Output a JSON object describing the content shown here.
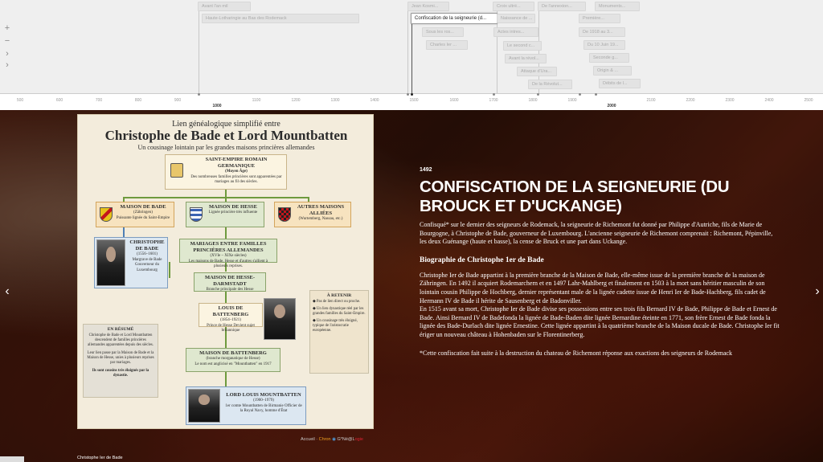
{
  "timeline": {
    "zoom_in": "+",
    "zoom_out": "−",
    "collapse": "›",
    "expand": "›",
    "events": [
      {
        "label": "Avant l'an mil"
      },
      {
        "label": "Haute-Lotharingie au Bas des Rodemack"
      },
      {
        "label": "Jean Kosmi..."
      },
      {
        "label": "Confiscation de la seigneurie (d..."
      },
      {
        "label": "Sous les ros..."
      },
      {
        "label": "Charles Ier ..."
      },
      {
        "label": "Croix ultrë..."
      },
      {
        "label": "Naissance de ..."
      },
      {
        "label": "Actes intres..."
      },
      {
        "label": "Le second c..."
      },
      {
        "label": "Avant la révol..."
      },
      {
        "label": "Attaque d'Ura..."
      },
      {
        "label": "De la Révolut..."
      },
      {
        "label": "De l'annexion..."
      },
      {
        "label": "Monuments..."
      },
      {
        "label": "Première..."
      },
      {
        "label": "De 1918 au 3..."
      },
      {
        "label": "Du 10 Juin 19..."
      },
      {
        "label": "Seconde g..."
      },
      {
        "label": "Origin & ..."
      },
      {
        "label": "Débits de l..."
      }
    ],
    "ticks": [
      "500",
      "600",
      "700",
      "800",
      "900",
      "1000",
      "1100",
      "1200",
      "1300",
      "1400",
      "1500",
      "1600",
      "1700",
      "1800",
      "1900",
      "2000",
      "2100",
      "2200",
      "2300",
      "2400",
      "2500"
    ]
  },
  "slide": {
    "year": "1492",
    "title": "CONFISCATION DE LA SEIGNEURIE (DU BROUCK ET D'UCKANGE)",
    "intro": "Confisqué* sur le dernier des seigneurs de Rodemack, la seigneurie de Richemont fut donné par Philippe d'Autriche, fils de Marie de Bourgogne, à Christophe de Bade, gouverneur de Luxembourg. L'ancienne seigneurie de Richemont comprenait : Richemont, Pépinville, les deux Guénange (haute et basse), la cense de Bruck et une part dans Uckange.",
    "subheading": "Biographie de Christophe 1er de Bade",
    "bio1": "Christophe Ier de Bade appartint à la première branche de la Maison de Bade, elle-même issue de la première branche de la maison de Zähringen. En 1492 il acquiert Rodemarchern et en 1497 Lahr-Mahlberg et finalement en 1503 à la mort sans héritier masculin de son lointain cousin Philippe de Hochberg, dernier représentant male de la lignée cadette issue de Henri Ier de Bade-Hachberg, fils cadet de Hermann IV de Bade il hérite de Sausenberg et de Badonviller.",
    "bio2": "En 1515 avant sa mort, Christophe Ier de Bade divise ses possessions entre ses trois fils Bernard IV de Bade, Philippe de Bade et Ernest de Bade. Ainsi Bernard IV de Badefonda la lignée de Bade-Baden dite lignée Bernardine éteinte en 1771, son frère Ernest de Bade fonda la lignée des Bade-Durlach dite lignée Ernestine. Cette lignée appartint à la quatrième branche de la Maison ducale de Bade. Christophe Ier fit ériger un nouveau château à Hohenbaden sur le Florentinerberg.",
    "footnote": "*Cette confiscation fait suite à la destruction du chateau de Richemont réponse aux exactions des seigneurs de Rodemack",
    "caption": "Christophe Ier de Bade",
    "nav_prev": "‹",
    "nav_next": "›"
  },
  "credits": {
    "prefix": "Accueil · ",
    "brand": "Chron",
    "sep": "◉",
    "gen": "G*Né@L",
    "end": "ogie"
  },
  "infographic": {
    "title1": "Lien généalogique simplifié entre",
    "title2": "Christophe de Bade et Lord Mountbatten",
    "title3": "Un cousinage lointain par les grandes maisons princières allemandes",
    "empire": {
      "t": "SAINT-EMPIRE ROMAIN GERMANIQUE",
      "s": "(Moyen Âge)",
      "d": "Des nombreuses familles princières sont apparentées par mariages au fil des siècles."
    },
    "bade": {
      "t": "MAISON DE BADE",
      "s": "(Zähringen)",
      "d": "Puissante lignée du Saint-Empire"
    },
    "hesse": {
      "t": "MAISON DE HESSE",
      "d": "Lignée princière très influente"
    },
    "autres": {
      "t": "AUTRES MAISONS ALLIÉES",
      "d": "(Wurtemberg, Nassau, etc.)"
    },
    "christophe": {
      "t": "CHRISTOPHE DE BADE",
      "s": "(1556–1601)",
      "d": "Margrave de Bade Gouverneur du Luxembourg"
    },
    "mariages": {
      "t": "MARIAGES ENTRE FAMILLES PRINCIÈRES ALLEMANDES",
      "s": "(XVIe – XIXe siècles)",
      "d": "Les maisons de Bade, Hesse et d'autres s'allient à plusieurs reprises."
    },
    "darmstadt": {
      "t": "MAISON DE HESSE-DARMSTADT",
      "d": "Branche principale des Hesse"
    },
    "louis": {
      "t": "LOUIS DE BATTENBERG",
      "s": "(1854–1921)",
      "d": "Prince de Hesse Devient sujet britannique"
    },
    "battenberg": {
      "t": "MAISON DE BATTENBERG",
      "s": "(branche morganatique de Hesse)",
      "d": "Le nom est anglicisé en \"Mountbatten\" en 1917"
    },
    "mountbatten": {
      "t": "LORD LOUIS MOUNTBATTEN",
      "s": "(1900–1979)",
      "d": "1er comte Mountbatten de Birmanie Officier de la Royal Navy, homme d'État"
    },
    "resume": {
      "t": "EN RÉSUMÉ",
      "d1": "Christophe de Bade et Lord Mountbatten descendent de familles princières allemandes apparentées depuis des siècles.",
      "d2": "Leur lien passe par la Maison de Bade et la Maison de Hesse, unies à plusieurs reprises par mariages.",
      "d3": "Ils sont cousins très éloignés par la dynastie."
    },
    "retenir": {
      "t": "À RETENIR",
      "p1": "Pas de lien direct ou proche.",
      "p2": "Un lien dynastique réel par les grandes familles du Saint-Empire.",
      "p3": "Un cousinage très éloigné, typique de l'aristocratie européenne."
    }
  }
}
